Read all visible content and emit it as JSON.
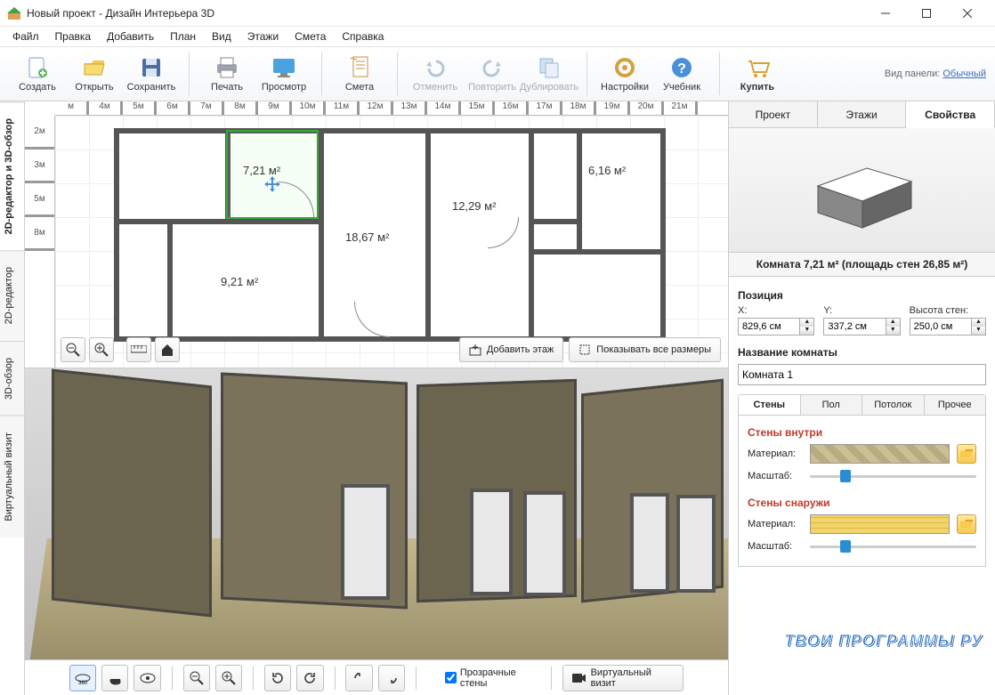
{
  "window": {
    "title": "Новый проект - Дизайн Интерьера 3D"
  },
  "menu": [
    "Файл",
    "Правка",
    "Добавить",
    "План",
    "Вид",
    "Этажи",
    "Смета",
    "Справка"
  ],
  "toolbar": {
    "create": "Создать",
    "open": "Открыть",
    "save": "Сохранить",
    "print": "Печать",
    "preview": "Просмотр",
    "estimate": "Смета",
    "undo": "Отменить",
    "redo": "Повторить",
    "dup": "Дублировать",
    "settings": "Настройки",
    "tutorial": "Учебник",
    "buy": "Купить",
    "panel_label": "Вид панели:",
    "panel_mode": "Обычный"
  },
  "side_tabs": [
    "2D-редактор и 3D-обзор",
    "2D-редактор",
    "3D-обзор",
    "Виртуальный визит"
  ],
  "ruler_h": [
    "м",
    "4м",
    "5м",
    "6м",
    "7м",
    "8м",
    "9м",
    "10м",
    "11м",
    "12м",
    "13м",
    "14м",
    "15м",
    "16м",
    "17м",
    "18м",
    "19м",
    "20м",
    "21м"
  ],
  "ruler_v": [
    "2м",
    "3м",
    "5м",
    "8м"
  ],
  "rooms": {
    "r1": "7,21 м²",
    "r2": "6,16 м²",
    "r3": "12,29 м²",
    "r4": "18,67 м²",
    "r5": "9,21 м²"
  },
  "plan_buttons": {
    "add_floor": "Добавить этаж",
    "show_dims": "Показывать все размеры"
  },
  "bottom": {
    "transparent": "Прозрачные стены",
    "vvisit": "Виртуальный визит"
  },
  "rpanel": {
    "tabs": [
      "Проект",
      "Этажи",
      "Свойства"
    ],
    "room_info": "Комната 7,21 м²  (площадь стен 26,85 м²)",
    "position": "Позиция",
    "x_lab": "X:",
    "y_lab": "Y:",
    "h_lab": "Высота стен:",
    "x": "829,6 см",
    "y": "337,2 см",
    "h": "250,0 см",
    "roomname_h": "Название комнаты",
    "roomname": "Комната 1",
    "subtabs": [
      "Стены",
      "Пол",
      "Потолок",
      "Прочее"
    ],
    "walls_in": "Стены внутри",
    "walls_out": "Стены снаружи",
    "material": "Материал:",
    "scale": "Масштаб:"
  },
  "watermark": "ТВОИ ПРОГРАММЫ РУ"
}
